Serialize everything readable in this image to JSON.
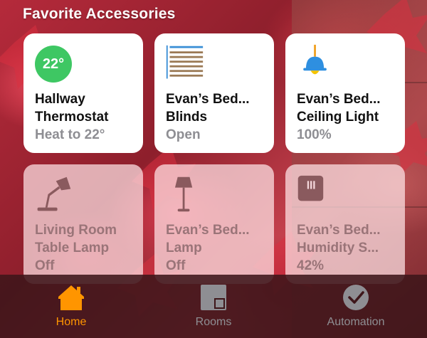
{
  "section_title": "Favorite Accessories",
  "colors": {
    "accent": "#ff9500",
    "thermostat_green": "#3ec763",
    "light_blue": "#2e8fe0",
    "tile_on": "#ffffff",
    "tile_off_text": "#9a7478"
  },
  "accessories": [
    {
      "name": "Hallway\nThermostat",
      "status": "Heat to 22°",
      "badge": "22°",
      "icon": "thermostat-icon",
      "state": "on"
    },
    {
      "name": "Evan’s Bed...\nBlinds",
      "status": "Open",
      "icon": "blinds-icon",
      "state": "on"
    },
    {
      "name": "Evan’s Bed...\nCeiling Light",
      "status": "100%",
      "icon": "ceiling-light-icon",
      "state": "on"
    },
    {
      "name": "Living Room\nTable Lamp",
      "status": "Off",
      "icon": "desk-lamp-icon",
      "state": "off"
    },
    {
      "name": "Evan’s Bed...\nLamp",
      "status": "Off",
      "icon": "floor-lamp-icon",
      "state": "off"
    },
    {
      "name": "Evan’s Bed...\nHumidity S...",
      "status": "42%",
      "icon": "humidity-sensor-icon",
      "state": "off"
    }
  ],
  "tabs": [
    {
      "label": "Home",
      "icon": "house-icon",
      "active": true
    },
    {
      "label": "Rooms",
      "icon": "rooms-icon",
      "active": false
    },
    {
      "label": "Automation",
      "icon": "automation-clock-icon",
      "active": false
    }
  ]
}
